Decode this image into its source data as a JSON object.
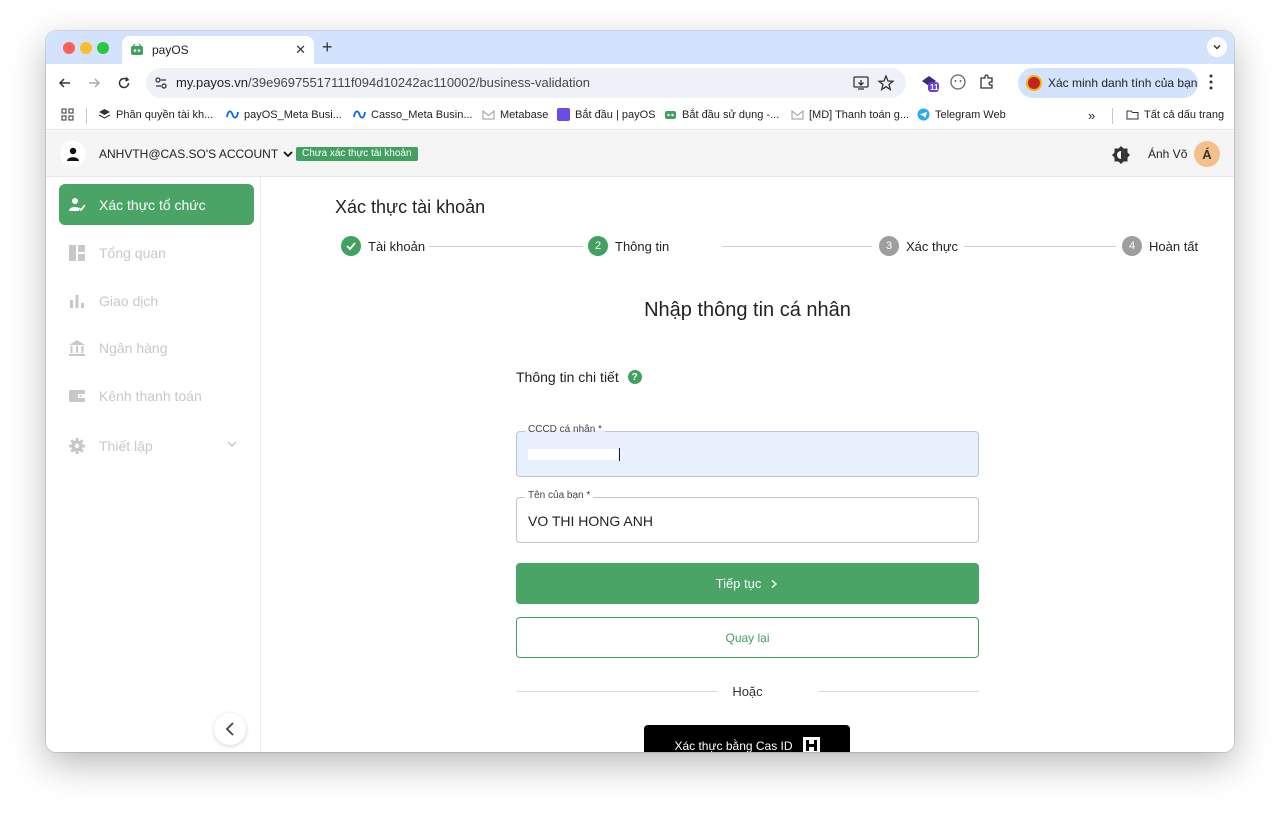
{
  "browser": {
    "tab_title": "payOS",
    "url_host": "my.payos.vn",
    "url_path": "/39e96975517111f094d10242ac110002/business-validation",
    "profile_chip": "Xác minh danh tính của bạn",
    "extension_badge": "11"
  },
  "bookmarks": {
    "items": [
      {
        "label": "Phân quyền tài kh..."
      },
      {
        "label": "payOS_Meta Busi..."
      },
      {
        "label": "Casso_Meta Busin..."
      },
      {
        "label": "Metabase"
      },
      {
        "label": "Bắt đầu | payOS"
      },
      {
        "label": "Bắt đầu sử dụng -..."
      },
      {
        "label": "[MD] Thanh toán g..."
      },
      {
        "label": "Telegram Web"
      }
    ],
    "overflow": "»",
    "all_bookmarks": "Tất cả dấu trang"
  },
  "header": {
    "account_name": "ANHVTH@CAS.SO'S ACCOUNT",
    "account_badge": "Chưa xác thực tài khoản",
    "user_name": "Ánh Võ",
    "user_initial": "Á"
  },
  "sidebar": {
    "items": [
      {
        "label": "Xác thực tổ chức"
      },
      {
        "label": "Tổng quan"
      },
      {
        "label": "Giao dịch"
      },
      {
        "label": "Ngân hàng"
      },
      {
        "label": "Kênh thanh toán"
      },
      {
        "label": "Thiết lập"
      }
    ]
  },
  "main": {
    "page_title": "Xác thực tài khoản",
    "steps": [
      {
        "number": "1",
        "label": "Tài khoản",
        "state": "done"
      },
      {
        "number": "2",
        "label": "Thông tin",
        "state": "current"
      },
      {
        "number": "3",
        "label": "Xác thực",
        "state": "pending"
      },
      {
        "number": "4",
        "label": "Hoàn tất",
        "state": "pending"
      }
    ],
    "section_title": "Nhập thông tin cá nhân",
    "detail_label": "Thông tin chi tiết",
    "help_glyph": "?",
    "fields": {
      "cccd": {
        "label": "CCCD cá nhân *",
        "value": ""
      },
      "name": {
        "label": "Tên của bạn *",
        "value": "VO THI HONG ANH"
      }
    },
    "continue_label": "Tiếp tục",
    "back_label": "Quay lại",
    "or_label": "Hoặc",
    "casid_label": "Xác thực bằng Cas ID"
  },
  "colors": {
    "brand_green": "#4aa466",
    "tab_strip": "#d3e3fd"
  }
}
